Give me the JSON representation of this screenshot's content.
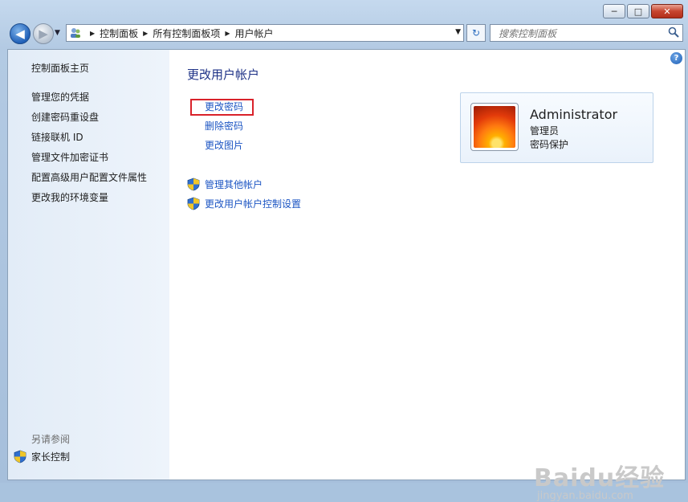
{
  "window": {
    "minimize_label": "─",
    "maximize_label": "□",
    "close_label": "✕"
  },
  "nav": {
    "back_glyph": "◀",
    "forward_glyph": "▶",
    "history_glyph": "▼",
    "breadcrumbs": [
      "控制面板",
      "所有控制面板项",
      "用户帐户"
    ],
    "refresh_glyph": "↻",
    "search_placeholder": "搜索控制面板"
  },
  "sidebar": {
    "home": "控制面板主页",
    "links": [
      "管理您的凭据",
      "创建密码重设盘",
      "链接联机 ID",
      "管理文件加密证书",
      "配置高级用户配置文件属性",
      "更改我的环境变量"
    ],
    "see_also": "另请参阅",
    "parental_controls": "家长控制"
  },
  "main": {
    "title": "更改用户帐户",
    "tasks": [
      "更改密码",
      "删除密码",
      "更改图片"
    ],
    "shield_links": [
      "管理其他帐户",
      "更改用户帐户控制设置"
    ],
    "help_label": "?"
  },
  "user": {
    "name": "Administrator",
    "role": "管理员",
    "protection": "密码保护"
  },
  "watermark": {
    "line1": "Baidu经验",
    "line2": "jingyan.baidu.com"
  },
  "colors": {
    "link": "#1c55c3",
    "title": "#1e3287",
    "highlight": "#d9222a"
  }
}
